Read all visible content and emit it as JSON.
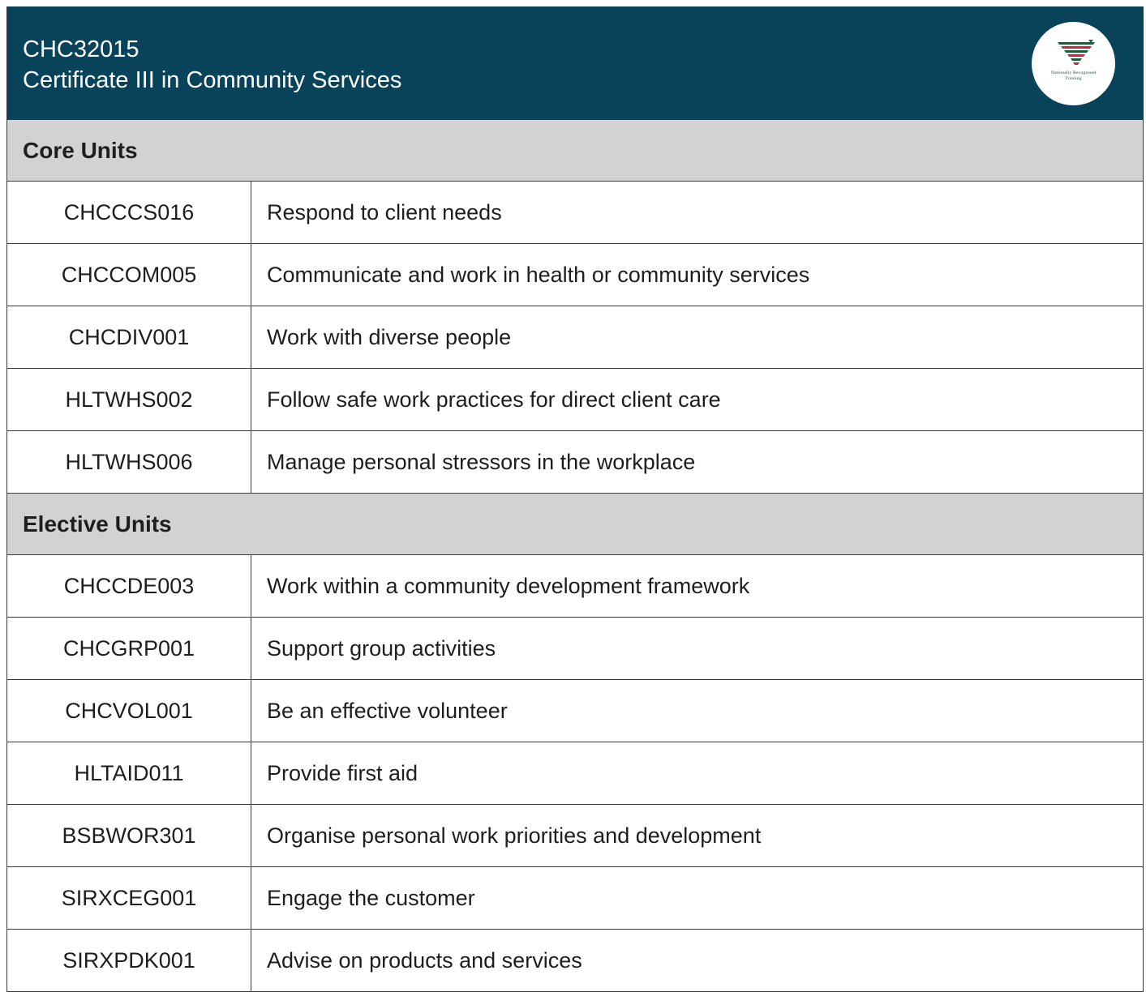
{
  "header": {
    "code": "CHC32015",
    "name": "Certificate III in Community Services",
    "logo_caption_line1": "Nationally Recognised",
    "logo_caption_line2": "Training"
  },
  "core": {
    "heading": "Core Units",
    "units": [
      {
        "code": "CHCCCS016",
        "title": "Respond to client needs"
      },
      {
        "code": "CHCCOM005",
        "title": "Communicate and work in health or community services"
      },
      {
        "code": "CHCDIV001",
        "title": "Work with diverse people"
      },
      {
        "code": "HLTWHS002",
        "title": "Follow safe work practices for direct client care"
      },
      {
        "code": "HLTWHS006",
        "title": "Manage personal stressors in the workplace"
      }
    ]
  },
  "elective": {
    "heading": "Elective Units",
    "units": [
      {
        "code": "CHCCDE003",
        "title": "Work within a community development framework"
      },
      {
        "code": "CHCGRP001",
        "title": "Support group activities"
      },
      {
        "code": "CHCVOL001",
        "title": "Be an effective volunteer"
      },
      {
        "code": "HLTAID011",
        "title": "Provide first aid"
      },
      {
        "code": "BSBWOR301",
        "title": "Organise personal work priorities and development"
      },
      {
        "code": "SIRXCEG001",
        "title": "Engage the customer"
      },
      {
        "code": "SIRXPDK001",
        "title": "Advise on products and services"
      }
    ]
  },
  "colors": {
    "header_bg": "#08435a",
    "section_bg": "#d1d2d4",
    "logo_green": "#1f5c3f",
    "logo_red": "#d4232f"
  }
}
